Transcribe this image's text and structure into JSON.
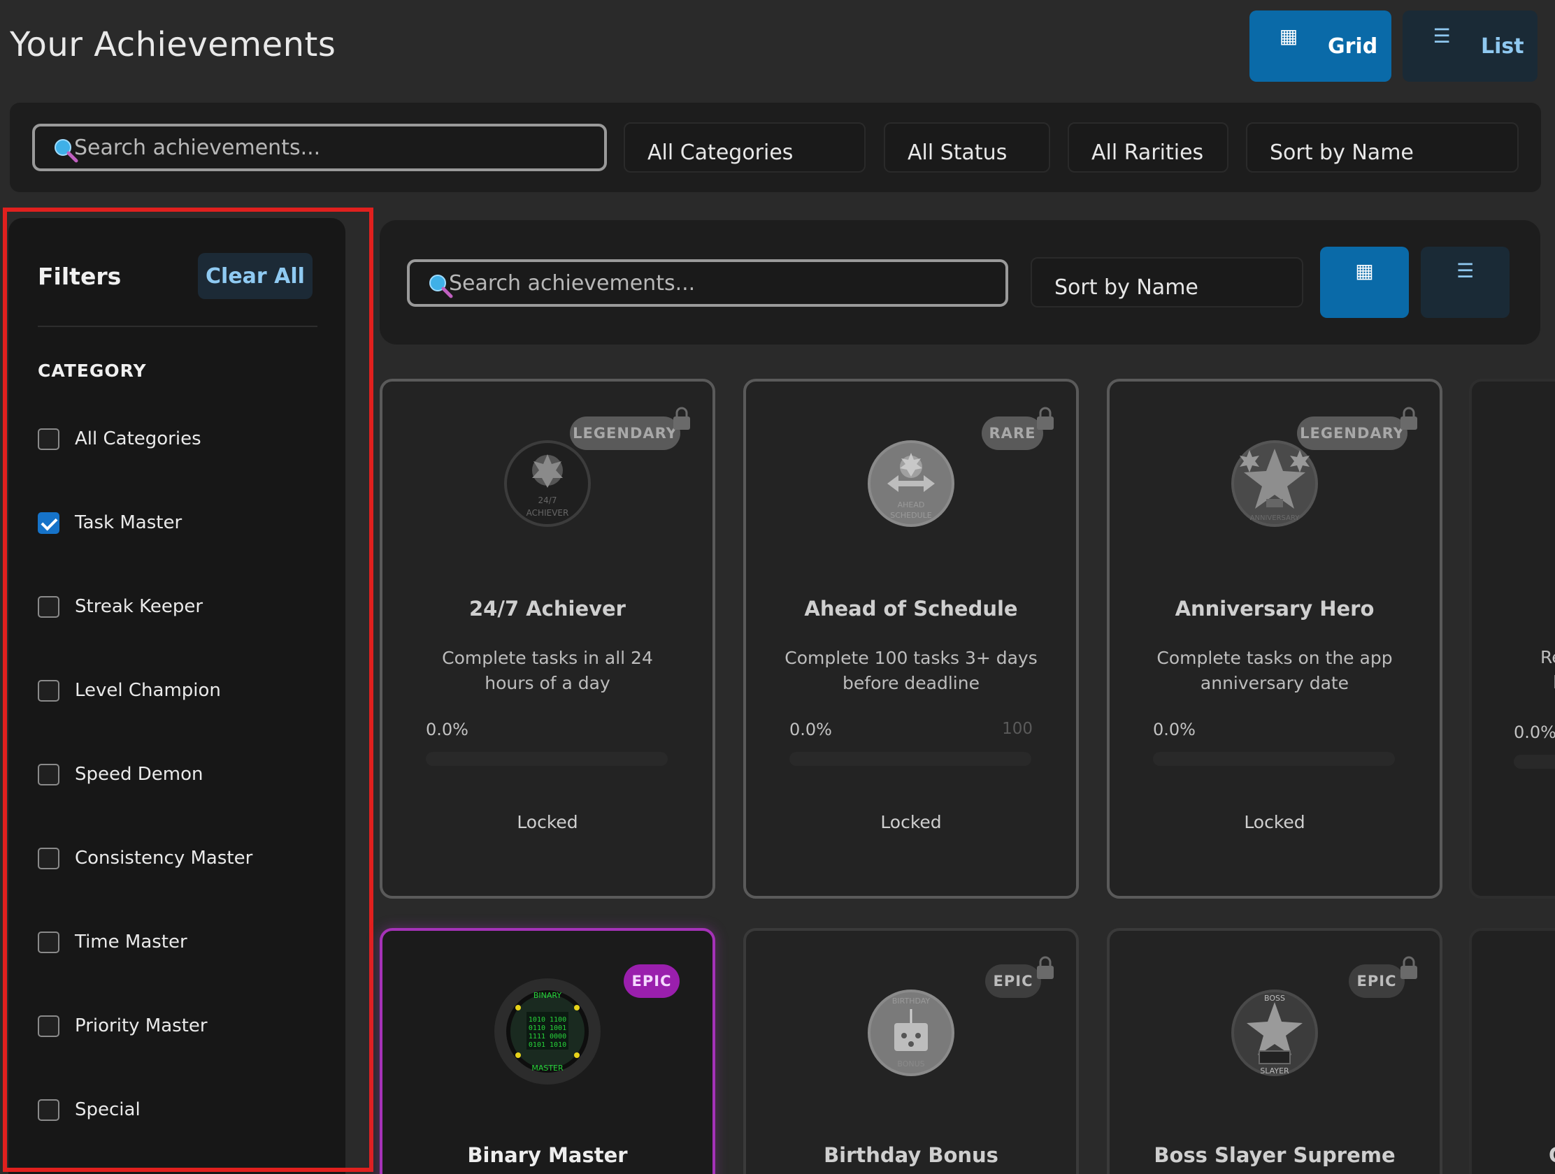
{
  "header": {
    "title": "Your Achievements",
    "view_toggle": {
      "grid_label": "Grid",
      "list_label": "List",
      "active": "Grid"
    }
  },
  "top_filters": {
    "search_placeholder": "Search achievements...",
    "category": "All Categories",
    "status": "All Status",
    "rarity": "All Rarities",
    "sort": "Sort by Name"
  },
  "sidebar": {
    "title": "Filters",
    "clear_all_label": "Clear All",
    "category_heading": "CATEGORY",
    "categories": [
      {
        "label": "All Categories",
        "checked": false
      },
      {
        "label": "Task Master",
        "checked": true
      },
      {
        "label": "Streak Keeper",
        "checked": false
      },
      {
        "label": "Level Champion",
        "checked": false
      },
      {
        "label": "Speed Demon",
        "checked": false
      },
      {
        "label": "Consistency Master",
        "checked": false
      },
      {
        "label": "Time Master",
        "checked": false
      },
      {
        "label": "Priority Master",
        "checked": false
      },
      {
        "label": "Special",
        "checked": false
      }
    ]
  },
  "inner_toolbar": {
    "search_placeholder": "Search achievements...",
    "sort": "Sort by Name"
  },
  "cards": [
    {
      "title": "24/7 Achiever",
      "description": "Complete tasks in all 24 hours of a day",
      "rarity": "LEGENDARY",
      "progress_text": "0.0%",
      "progress": 0,
      "target": "",
      "status": "Locked",
      "locked": true,
      "medal_text": [
        "24/7",
        "ACHIEVER"
      ]
    },
    {
      "title": "Ahead of Schedule",
      "description": "Complete 100 tasks 3+ days before deadline",
      "rarity": "RARE",
      "progress_text": "0.0%",
      "progress": 0,
      "target": "100",
      "status": "Locked",
      "locked": true,
      "medal_text": [
        "AHEAD",
        "SCHEDULE"
      ]
    },
    {
      "title": "Anniversary Hero",
      "description": "Complete tasks on the app anniversary date",
      "rarity": "LEGENDARY",
      "progress_text": "0.0%",
      "progress": 0,
      "target": "",
      "status": "Locked",
      "locked": true,
      "medal_text": [
        "ANNIVERSARY"
      ]
    },
    {
      "title": "Binary Master",
      "rarity": "EPIC",
      "locked": false,
      "medal_text": [
        "BINARY",
        "1010 1100",
        "0110 1001",
        "1111 0000",
        "0101 1010",
        "MASTER"
      ]
    },
    {
      "title": "Birthday Bonus",
      "rarity": "EPIC",
      "locked": true,
      "medal_text": [
        "BIRTHDAY",
        "BONUS"
      ]
    },
    {
      "title": "Boss Slayer Supreme",
      "rarity": "EPIC",
      "locked": true,
      "medal_text": [
        "BOSS",
        "SLAYER"
      ]
    }
  ],
  "partial_card": {
    "description_fragment": [
      "Re",
      "l"
    ],
    "progress_text": "0.0%",
    "title_fragment": "C"
  },
  "colors": {
    "accent": "#0a6aa8",
    "epic": "#9a1fad",
    "checkbox_checked": "#1673c9",
    "highlight_outline": "#e0201e"
  },
  "icons": {
    "grid": "grid-icon",
    "list": "list-icon",
    "search": "magnifier-icon",
    "lock": "lock-icon"
  }
}
